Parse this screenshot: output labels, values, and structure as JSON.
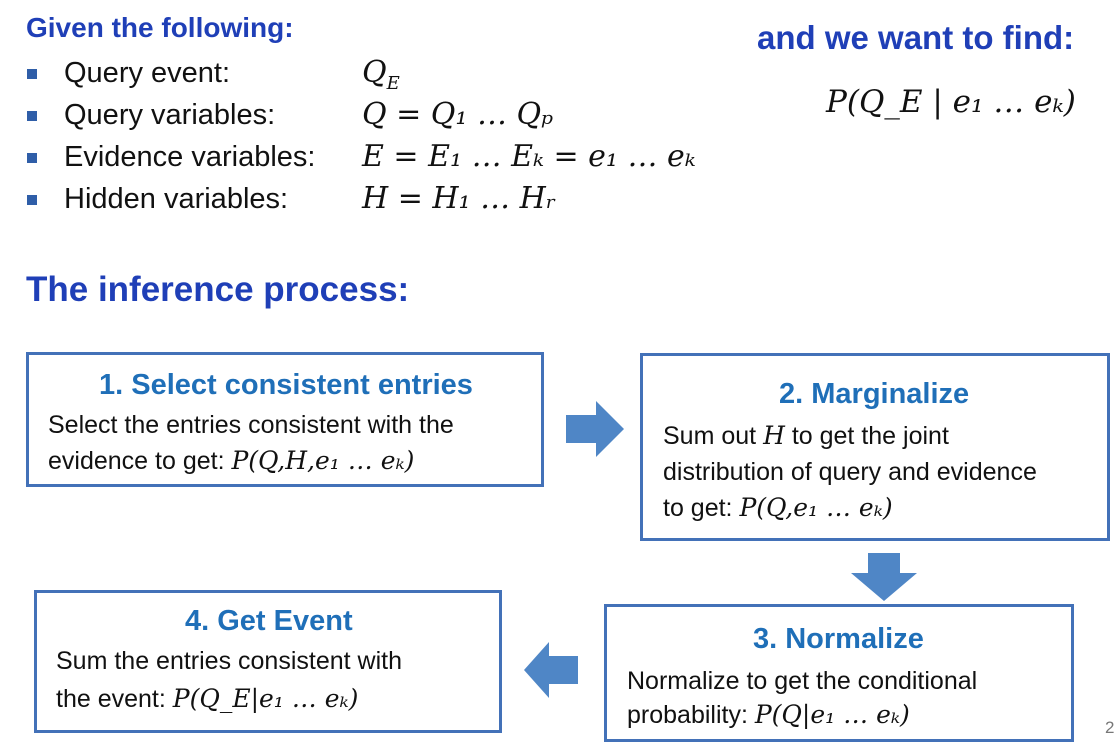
{
  "given": {
    "title": "Given the following:",
    "items": [
      {
        "label": "Query event:",
        "formula": "Q_E"
      },
      {
        "label": "Query variables:",
        "formula": "Q = Q₁ … Qₚ"
      },
      {
        "label": "Evidence variables:",
        "formula": "E = E₁ … Eₖ = e₁ … eₖ"
      },
      {
        "label": "Hidden variables:",
        "formula": "H = H₁ … Hᵣ"
      }
    ]
  },
  "target": {
    "title": "and we want to find:",
    "formula": "P(Q_E | e₁ … eₖ)"
  },
  "process": {
    "title": "The inference process:",
    "steps": [
      {
        "title": "1. Select consistent entries",
        "lines": [
          "Select the entries consistent with the",
          "evidence to get:"
        ],
        "formula": "P(Q,H,e₁ … eₖ)"
      },
      {
        "title": "2. Marginalize",
        "line_1_prefix": "Sum out",
        "line_1_var": "H",
        "line_1_suffix": "to get the joint",
        "line_2": "distribution of query and evidence",
        "line_3": "to get:",
        "formula": "P(Q,e₁ … eₖ)"
      },
      {
        "title": "3. Normalize",
        "lines": [
          "Normalize to get the conditional",
          "probability:"
        ],
        "formula": "P(Q|e₁ … eₖ)"
      },
      {
        "title": "4. Get Event",
        "lines": [
          "Sum the entries consistent with",
          "the event:"
        ],
        "formula": "P(Q_E|e₁ … eₖ)"
      }
    ]
  },
  "arrows": [
    {
      "name": "right-arrow-icon",
      "direction": "right"
    },
    {
      "name": "down-arrow-icon",
      "direction": "down"
    },
    {
      "name": "left-arrow-icon",
      "direction": "left"
    }
  ],
  "page_number": "2",
  "colors": {
    "heading": "#1f3fb7",
    "box_title": "#1f6fb8",
    "box_border": "#4371b8",
    "arrow": "#4f86c6",
    "bullet": "#2f5ea8"
  }
}
